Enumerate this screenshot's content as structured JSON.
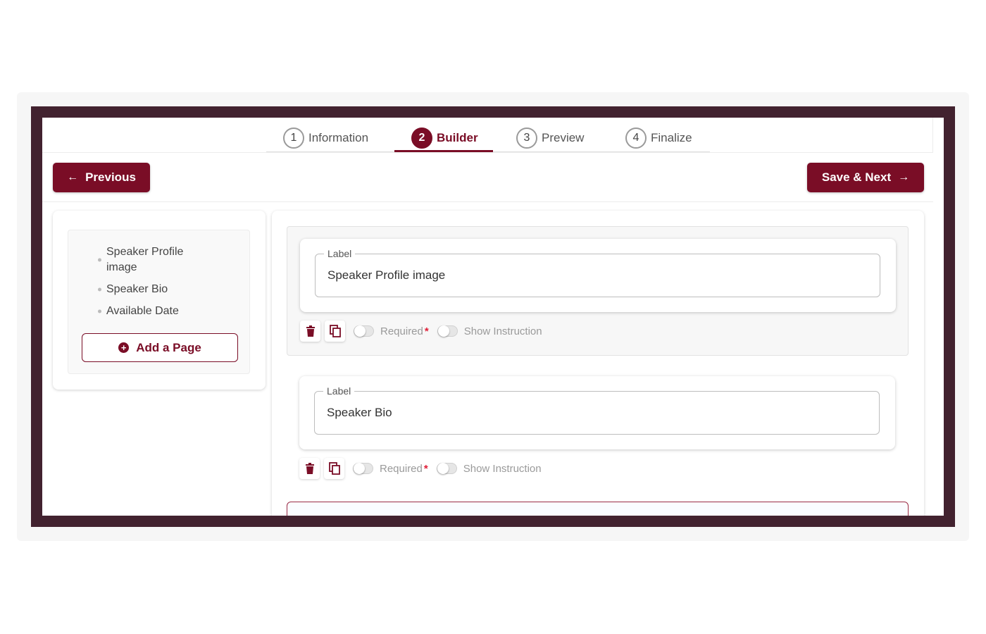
{
  "stepper": {
    "steps": [
      {
        "num": "1",
        "label": "Information"
      },
      {
        "num": "2",
        "label": "Builder"
      },
      {
        "num": "3",
        "label": "Preview"
      },
      {
        "num": "4",
        "label": "Finalize"
      }
    ],
    "active_step": "Builder"
  },
  "toolbar": {
    "previous_label": "Previous",
    "save_next_label": "Save & Next"
  },
  "sidebar": {
    "pages": [
      "Speaker Profile image",
      "Speaker Bio",
      "Available Date"
    ],
    "add_page_label": "Add a Page"
  },
  "builder": {
    "fields": [
      {
        "legend": "Label",
        "value": "Speaker Profile image",
        "required_label": "Required",
        "required_mark": "*",
        "instruction_label": "Show Instruction"
      },
      {
        "legend": "Label",
        "value": "Speaker Bio",
        "required_label": "Required",
        "required_mark": "*",
        "instruction_label": "Show Instruction"
      }
    ]
  },
  "colors": {
    "accent": "#7a0d26",
    "frame": "#42222f",
    "required": "#e01e37"
  },
  "icons": [
    "arrow-left-icon",
    "arrow-right-icon",
    "plus-circle-icon",
    "trash-icon",
    "copy-icon"
  ]
}
